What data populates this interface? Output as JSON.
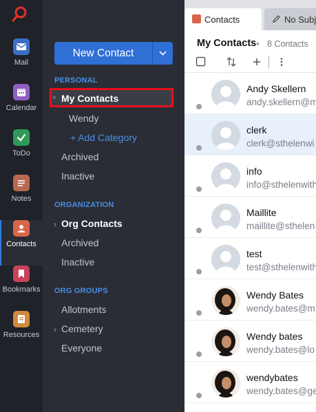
{
  "rail": {
    "items": [
      {
        "label": "Mail",
        "color": "#3b6fc4"
      },
      {
        "label": "Calendar",
        "color": "#8e5fc1"
      },
      {
        "label": "ToDo",
        "color": "#2f9a58"
      },
      {
        "label": "Notes",
        "color": "#b96a52"
      },
      {
        "label": "Contacts",
        "color": "#d9664a"
      },
      {
        "label": "Bookmarks",
        "color": "#c7435a"
      },
      {
        "label": "Resources",
        "color": "#cf8a3a"
      }
    ],
    "active": "Contacts",
    "accent": "#2f7de1"
  },
  "panel": {
    "new_contact_label": "New Contact",
    "personal_header": "PERSONAL",
    "my_contacts": "My Contacts",
    "wendy": "Wendy",
    "add_category": "+ Add Category",
    "personal_archived": "Archived",
    "personal_inactive": "Inactive",
    "organization_header": "ORGANIZATION",
    "org_contacts": "Org Contacts",
    "org_archived": "Archived",
    "org_inactive": "Inactive",
    "org_groups_header": "ORG GROUPS",
    "allotments": "Allotments",
    "cemetery": "Cemetery",
    "everyone": "Everyone"
  },
  "tabs": {
    "active": "Contacts",
    "second": "No Subje"
  },
  "list_header": {
    "title": "My Contacts",
    "separator": "•",
    "count": "8 Contacts"
  },
  "contacts": [
    {
      "name": "Andy Skellern",
      "email": "andy.skellern@m",
      "avatar": "generic"
    },
    {
      "name": "clerk",
      "email": "clerk@sthelenwi",
      "avatar": "generic",
      "selected": true
    },
    {
      "name": "info",
      "email": "info@sthelenwith",
      "avatar": "generic"
    },
    {
      "name": "Maillite",
      "email": "maillite@sthelen",
      "avatar": "generic"
    },
    {
      "name": "test",
      "email": "test@sthelenwith",
      "avatar": "generic"
    },
    {
      "name": "Wendy Bates",
      "email": "wendy.bates@m",
      "avatar": "photo"
    },
    {
      "name": "Wendy bates",
      "email": "wendy.bates@lo",
      "avatar": "photo"
    },
    {
      "name": "wendybates",
      "email": "wendy.bates@ge",
      "avatar": "photo"
    }
  ]
}
